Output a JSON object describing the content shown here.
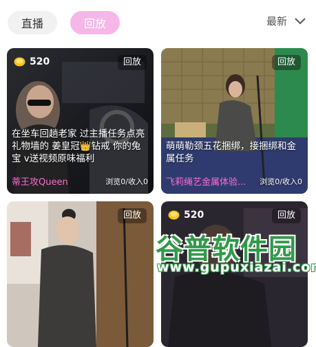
{
  "tabs": {
    "live": "直播",
    "replay": "回放"
  },
  "sort": {
    "label": "最新"
  },
  "cards": [
    {
      "coins": "520",
      "badge": "回放",
      "title": "在坐车回趟老家 过主播任务点亮礼物墙的 姜皇冠👑钻戒 你的兔宝     v送视频原味福利",
      "streamer": "蒂王攻Queen",
      "stats": "浏览0/收入0"
    },
    {
      "badge": "回放",
      "title": "萌萌勒颈五花捆绑，接捆绑和金属任务",
      "streamer": "飞莉绳艺金属体验...",
      "stats": "浏览0/收入0"
    },
    {
      "badge": "回放"
    },
    {
      "coins": "520",
      "badge": "回放"
    }
  ],
  "watermark": {
    "name": "谷普软件园",
    "url": "www.gupuxiazai.com"
  }
}
